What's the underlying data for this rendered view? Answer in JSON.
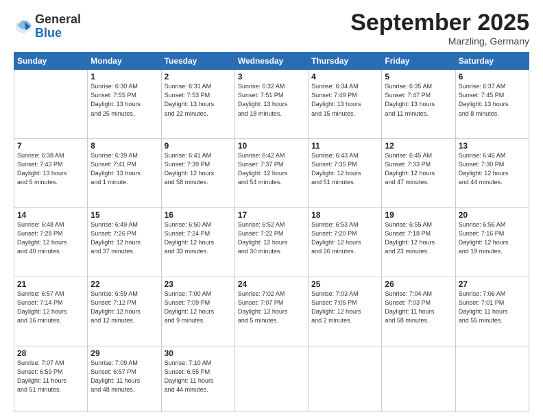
{
  "header": {
    "logo": {
      "general": "General",
      "blue": "Blue"
    },
    "title": "September 2025",
    "subtitle": "Marzling, Germany"
  },
  "days_of_week": [
    "Sunday",
    "Monday",
    "Tuesday",
    "Wednesday",
    "Thursday",
    "Friday",
    "Saturday"
  ],
  "weeks": [
    [
      {
        "day": "",
        "content": ""
      },
      {
        "day": "1",
        "content": "Sunrise: 6:30 AM\nSunset: 7:55 PM\nDaylight: 13 hours\nand 25 minutes."
      },
      {
        "day": "2",
        "content": "Sunrise: 6:31 AM\nSunset: 7:53 PM\nDaylight: 13 hours\nand 22 minutes."
      },
      {
        "day": "3",
        "content": "Sunrise: 6:32 AM\nSunset: 7:51 PM\nDaylight: 13 hours\nand 18 minutes."
      },
      {
        "day": "4",
        "content": "Sunrise: 6:34 AM\nSunset: 7:49 PM\nDaylight: 13 hours\nand 15 minutes."
      },
      {
        "day": "5",
        "content": "Sunrise: 6:35 AM\nSunset: 7:47 PM\nDaylight: 13 hours\nand 11 minutes."
      },
      {
        "day": "6",
        "content": "Sunrise: 6:37 AM\nSunset: 7:45 PM\nDaylight: 13 hours\nand 8 minutes."
      }
    ],
    [
      {
        "day": "7",
        "content": "Sunrise: 6:38 AM\nSunset: 7:43 PM\nDaylight: 13 hours\nand 5 minutes."
      },
      {
        "day": "8",
        "content": "Sunrise: 6:39 AM\nSunset: 7:41 PM\nDaylight: 13 hours\nand 1 minute."
      },
      {
        "day": "9",
        "content": "Sunrise: 6:41 AM\nSunset: 7:39 PM\nDaylight: 12 hours\nand 58 minutes."
      },
      {
        "day": "10",
        "content": "Sunrise: 6:42 AM\nSunset: 7:37 PM\nDaylight: 12 hours\nand 54 minutes."
      },
      {
        "day": "11",
        "content": "Sunrise: 6:43 AM\nSunset: 7:35 PM\nDaylight: 12 hours\nand 51 minutes."
      },
      {
        "day": "12",
        "content": "Sunrise: 6:45 AM\nSunset: 7:33 PM\nDaylight: 12 hours\nand 47 minutes."
      },
      {
        "day": "13",
        "content": "Sunrise: 6:46 AM\nSunset: 7:30 PM\nDaylight: 12 hours\nand 44 minutes."
      }
    ],
    [
      {
        "day": "14",
        "content": "Sunrise: 6:48 AM\nSunset: 7:28 PM\nDaylight: 12 hours\nand 40 minutes."
      },
      {
        "day": "15",
        "content": "Sunrise: 6:49 AM\nSunset: 7:26 PM\nDaylight: 12 hours\nand 37 minutes."
      },
      {
        "day": "16",
        "content": "Sunrise: 6:50 AM\nSunset: 7:24 PM\nDaylight: 12 hours\nand 33 minutes."
      },
      {
        "day": "17",
        "content": "Sunrise: 6:52 AM\nSunset: 7:22 PM\nDaylight: 12 hours\nand 30 minutes."
      },
      {
        "day": "18",
        "content": "Sunrise: 6:53 AM\nSunset: 7:20 PM\nDaylight: 12 hours\nand 26 minutes."
      },
      {
        "day": "19",
        "content": "Sunrise: 6:55 AM\nSunset: 7:18 PM\nDaylight: 12 hours\nand 23 minutes."
      },
      {
        "day": "20",
        "content": "Sunrise: 6:56 AM\nSunset: 7:16 PM\nDaylight: 12 hours\nand 19 minutes."
      }
    ],
    [
      {
        "day": "21",
        "content": "Sunrise: 6:57 AM\nSunset: 7:14 PM\nDaylight: 12 hours\nand 16 minutes."
      },
      {
        "day": "22",
        "content": "Sunrise: 6:59 AM\nSunset: 7:12 PM\nDaylight: 12 hours\nand 12 minutes."
      },
      {
        "day": "23",
        "content": "Sunrise: 7:00 AM\nSunset: 7:09 PM\nDaylight: 12 hours\nand 9 minutes."
      },
      {
        "day": "24",
        "content": "Sunrise: 7:02 AM\nSunset: 7:07 PM\nDaylight: 12 hours\nand 5 minutes."
      },
      {
        "day": "25",
        "content": "Sunrise: 7:03 AM\nSunset: 7:05 PM\nDaylight: 12 hours\nand 2 minutes."
      },
      {
        "day": "26",
        "content": "Sunrise: 7:04 AM\nSunset: 7:03 PM\nDaylight: 11 hours\nand 58 minutes."
      },
      {
        "day": "27",
        "content": "Sunrise: 7:06 AM\nSunset: 7:01 PM\nDaylight: 11 hours\nand 55 minutes."
      }
    ],
    [
      {
        "day": "28",
        "content": "Sunrise: 7:07 AM\nSunset: 6:59 PM\nDaylight: 11 hours\nand 51 minutes."
      },
      {
        "day": "29",
        "content": "Sunrise: 7:09 AM\nSunset: 6:57 PM\nDaylight: 11 hours\nand 48 minutes."
      },
      {
        "day": "30",
        "content": "Sunrise: 7:10 AM\nSunset: 6:55 PM\nDaylight: 11 hours\nand 44 minutes."
      },
      {
        "day": "",
        "content": ""
      },
      {
        "day": "",
        "content": ""
      },
      {
        "day": "",
        "content": ""
      },
      {
        "day": "",
        "content": ""
      }
    ]
  ]
}
